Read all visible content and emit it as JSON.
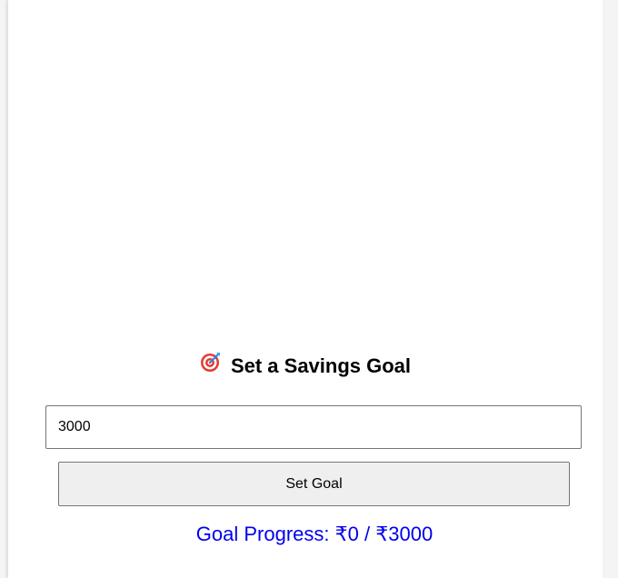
{
  "goal_section": {
    "icon": "target-dart-icon",
    "title": "Set a Savings Goal",
    "input_value": "3000",
    "button_label": "Set Goal",
    "progress": {
      "label": "Goal Progress:",
      "saved": "₹0",
      "separator": "/",
      "goal": "₹3000"
    }
  },
  "colors": {
    "progress_text": "#0000ee",
    "button_bg": "#efefef"
  }
}
